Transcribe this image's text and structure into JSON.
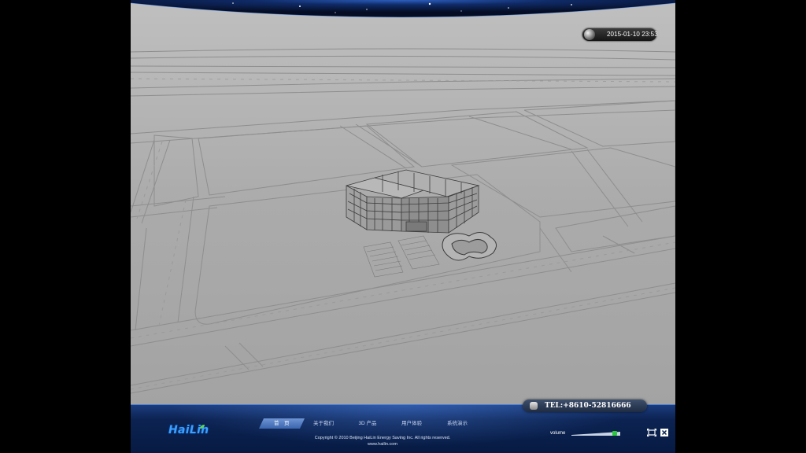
{
  "clock": {
    "datetime": "2015-01-10 23:53"
  },
  "contact": {
    "tel": "TEL:+8610-52816666"
  },
  "brand": {
    "logo_text": "HaiLin"
  },
  "nav": {
    "items": [
      {
        "label": "首　页",
        "active": true
      },
      {
        "label": "关于我们",
        "active": false
      },
      {
        "label": "3D 产品",
        "active": false
      },
      {
        "label": "用户体验",
        "active": false
      },
      {
        "label": "系统演示",
        "active": false
      }
    ]
  },
  "footer": {
    "copyright": "Copyright © 2010 Beijing HaiLin Energy Saving Inc. All rights reserved.",
    "website": "www.hailin.com"
  },
  "volume": {
    "label": "volume",
    "level": 0.92
  },
  "colors": {
    "accent": "#3aa0ff",
    "footer_bg": "#0c2352",
    "volume_knob": "#28c83a"
  },
  "icons": {
    "fullscreen": "fullscreen-icon",
    "close": "close-icon",
    "clock": "moon-orb-icon",
    "phone": "phone-icon"
  }
}
